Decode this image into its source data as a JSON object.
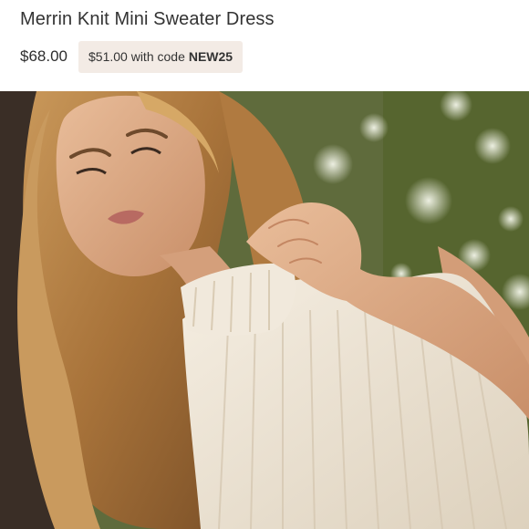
{
  "product": {
    "title": "Merrin Knit Mini Sweater Dress",
    "price": "$68.00",
    "promo": {
      "prefix": "$51.00 with code",
      "code": "NEW25"
    }
  },
  "image": {
    "subject": "product-photo",
    "colors": {
      "sweater": "#efe6d6",
      "hair": "#b8864a",
      "skin": "#e0b08c",
      "foliage": "#4d5d2e",
      "background_dark": "#3a2e26"
    }
  }
}
